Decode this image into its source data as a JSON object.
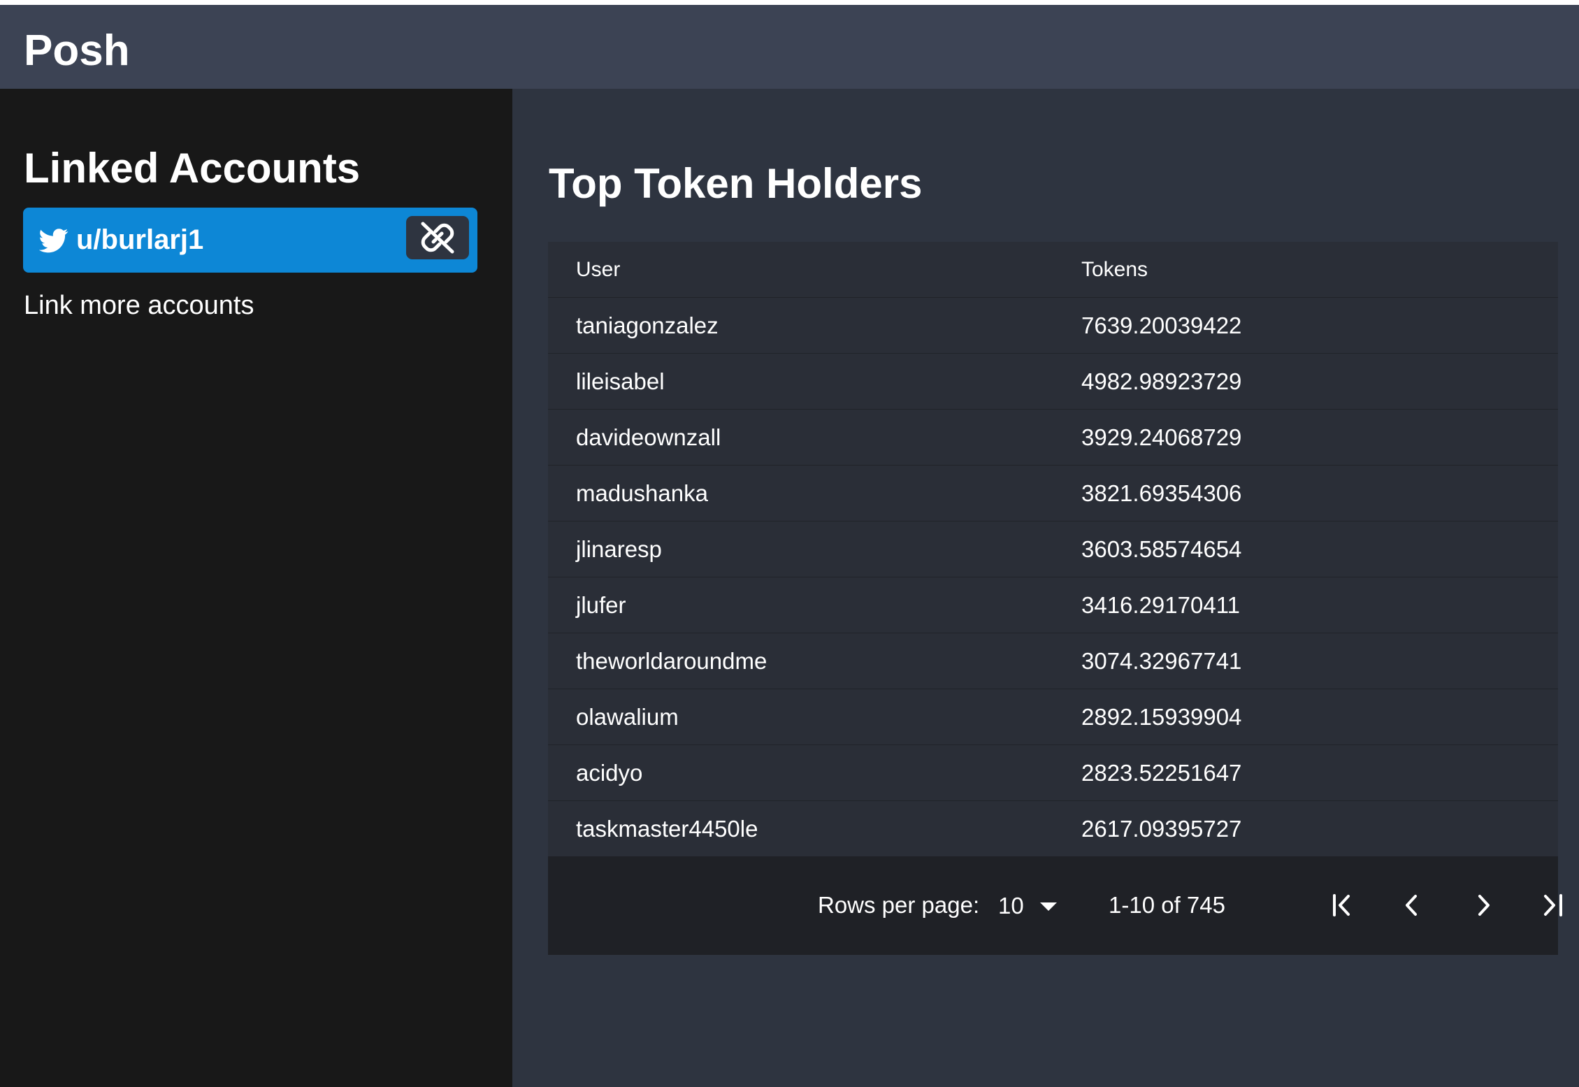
{
  "app": {
    "title": "Posh"
  },
  "sidebar": {
    "title": "Linked Accounts",
    "accounts": [
      {
        "name": "u/burlarj1",
        "icon": "twitter-icon",
        "action_icon": "unlink-icon"
      }
    ],
    "link_more_label": "Link more accounts"
  },
  "main": {
    "title": "Top Token Holders",
    "table": {
      "headers": [
        "User",
        "Tokens"
      ],
      "rows": [
        [
          "taniagonzalez",
          "7639.20039422"
        ],
        [
          "lileisabel",
          "4982.98923729"
        ],
        [
          "davideownzall",
          "3929.24068729"
        ],
        [
          "madushanka",
          "3821.69354306"
        ],
        [
          "jlinaresp",
          "3603.58574654"
        ],
        [
          "jlufer",
          "3416.29170411"
        ],
        [
          "theworldaroundme",
          "3074.32967741"
        ],
        [
          "olawalium",
          "2892.15939904"
        ],
        [
          "acidyo",
          "2823.52251647"
        ],
        [
          "taskmaster4450le",
          "2617.09395727"
        ]
      ]
    },
    "pagination": {
      "rows_per_page_label": "Rows per page:",
      "rows_per_page_value": "10",
      "range_text": "1-10 of 745",
      "buttons": [
        "first-page-icon",
        "previous-page-icon",
        "next-page-icon",
        "last-page-icon"
      ]
    }
  },
  "colors": {
    "header_bg": "#3c4354",
    "sidebar_bg": "#181818",
    "main_bg": "#2e3440",
    "accent": "#0d87d6",
    "table_row_bg": "#2a2e37",
    "pager_bg": "#1f2126"
  }
}
